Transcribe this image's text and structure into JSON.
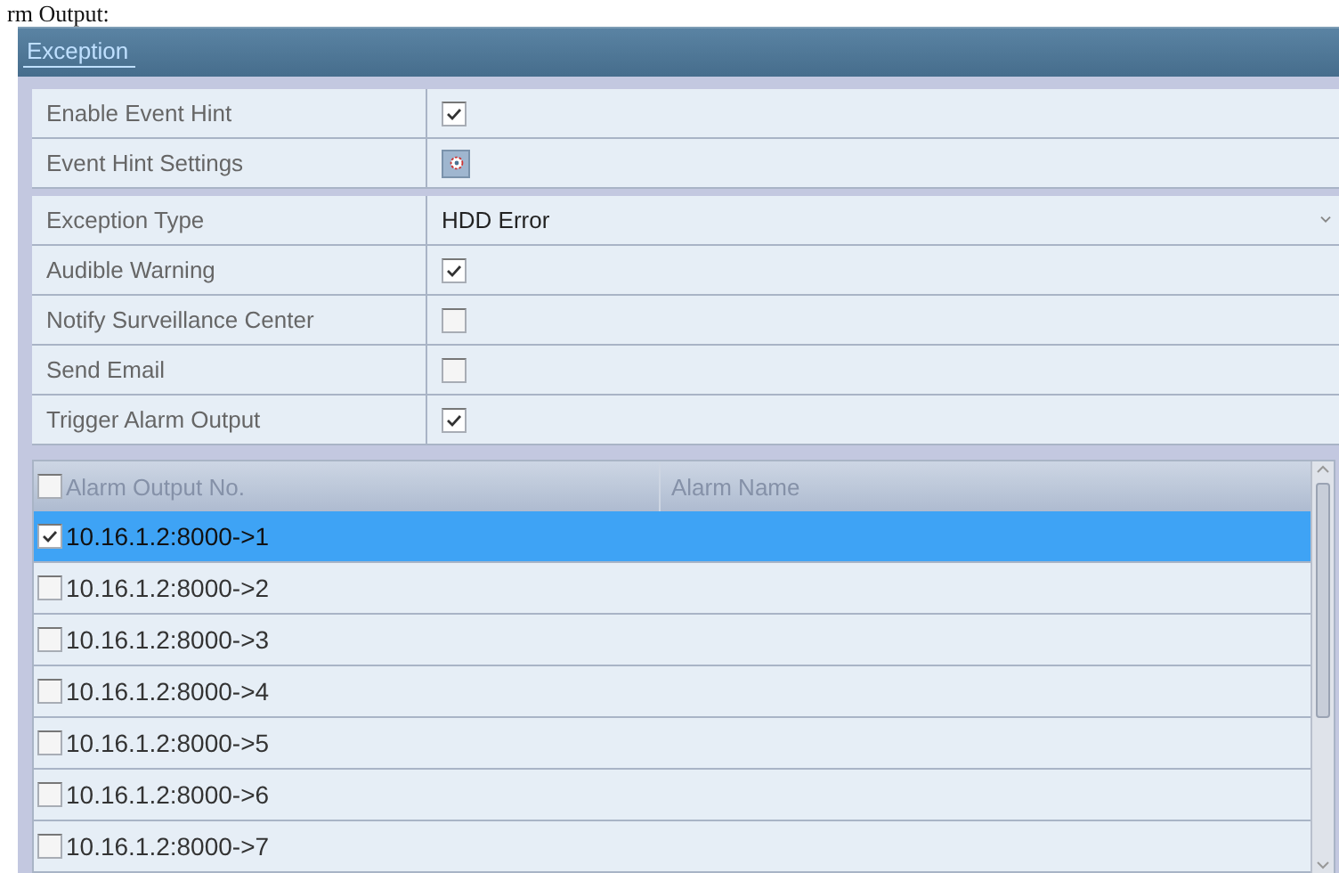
{
  "caption": "rm Output:",
  "panel": {
    "title": "Exception"
  },
  "settings": [
    {
      "kind": "checkbox",
      "label": "Enable Event Hint",
      "checked": true
    },
    {
      "kind": "button",
      "label": "Event Hint Settings"
    },
    {
      "kind": "dropdown",
      "label": "Exception Type",
      "value": "HDD Error"
    },
    {
      "kind": "checkbox",
      "label": "Audible Warning",
      "checked": true
    },
    {
      "kind": "checkbox",
      "label": "Notify Surveillance Center",
      "checked": false
    },
    {
      "kind": "checkbox",
      "label": "Send Email",
      "checked": false
    },
    {
      "kind": "checkbox",
      "label": "Trigger Alarm Output",
      "checked": true
    }
  ],
  "table": {
    "select_all_checked": false,
    "columns": [
      "Alarm Output No.",
      "Alarm Name"
    ],
    "rows": [
      {
        "output": "10.16.1.2:8000->1",
        "checked": true,
        "selected": true
      },
      {
        "output": "10.16.1.2:8000->2",
        "checked": false,
        "selected": false
      },
      {
        "output": "10.16.1.2:8000->3",
        "checked": false,
        "selected": false
      },
      {
        "output": "10.16.1.2:8000->4",
        "checked": false,
        "selected": false
      },
      {
        "output": "10.16.1.2:8000->5",
        "checked": false,
        "selected": false
      },
      {
        "output": "10.16.1.2:8000->6",
        "checked": false,
        "selected": false
      },
      {
        "output": "10.16.1.2:8000->7",
        "checked": false,
        "selected": false
      }
    ]
  }
}
